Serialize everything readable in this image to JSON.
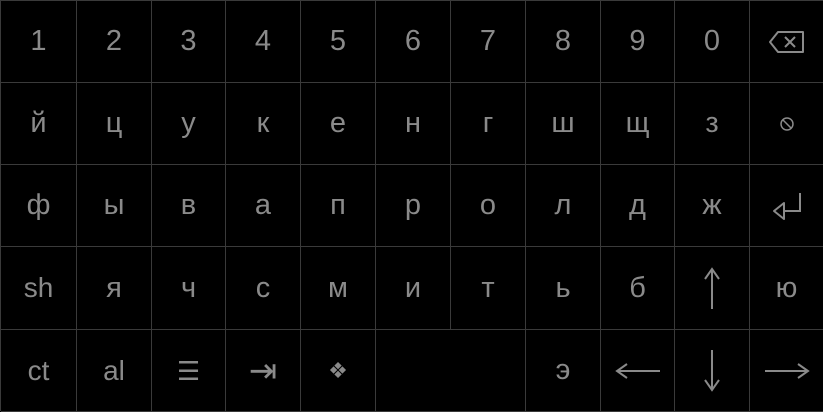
{
  "keyboard": {
    "rows": [
      [
        "1",
        "2",
        "3",
        "4",
        "5",
        "6",
        "7",
        "8",
        "9",
        "0"
      ],
      [
        "й",
        "ц",
        "у",
        "к",
        "е",
        "н",
        "г",
        "ш",
        "щ",
        "з"
      ],
      [
        "ф",
        "ы",
        "в",
        "а",
        "п",
        "р",
        "о",
        "л",
        "д",
        "ж"
      ],
      [
        "sh",
        "я",
        "ч",
        "с",
        "м",
        "и",
        "т",
        "ь",
        "б"
      ],
      [
        "ct",
        "al",
        "☰",
        "⇥",
        "❖",
        "",
        "э"
      ]
    ],
    "last_col": {
      "row0": "backspace-icon",
      "row1": "dismiss-icon",
      "row2": "enter-icon",
      "row3_up": "arrow-up-icon",
      "row3_last": "ю",
      "row4_left": "arrow-left-icon",
      "row4_down": "arrow-down-icon",
      "row4_right": "arrow-right-icon"
    },
    "colors": {
      "background": "#000000",
      "grid": "#3a3a3a",
      "text": "#8a8a8a"
    }
  }
}
